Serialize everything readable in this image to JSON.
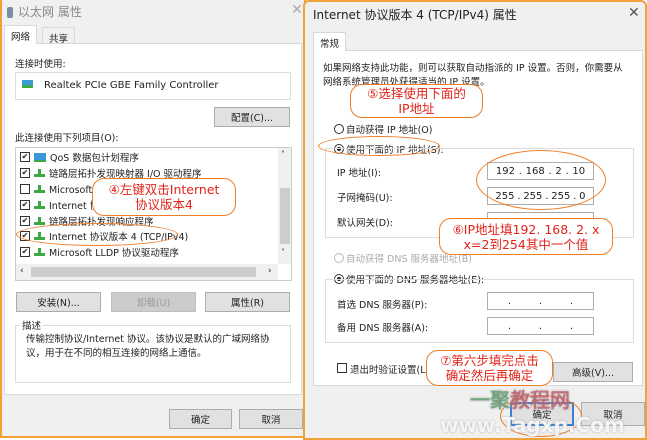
{
  "left_dialog": {
    "title": "以太网 属性",
    "tabs": [
      "网络",
      "共享"
    ],
    "connect_using_label": "连接时使用:",
    "adapter": "Realtek PCIe GBE Family Controller",
    "configure_button": "配置(C)...",
    "items_label": "此连接使用下列项目(O):",
    "items": [
      {
        "label": "QoS 数据包计划程序",
        "checked": true
      },
      {
        "label": "链路层拓扑发现映射器 I/O 驱动程序",
        "checked": true
      },
      {
        "label": "Microsoft 网络适配器多路传送器协议",
        "checked": false
      },
      {
        "label": "Internet 协议版本 6 (TCP/IPv6)",
        "checked": true
      },
      {
        "label": "链路层拓扑发现响应程序",
        "checked": true
      },
      {
        "label": "Internet 协议版本 4 (TCP/IPv4)",
        "checked": true
      },
      {
        "label": "Microsoft LLDP 协议驱动程序",
        "checked": true
      }
    ],
    "install_button": "安装(N)...",
    "uninstall_button": "卸载(U)",
    "properties_button": "属性(R)",
    "description_label": "描述",
    "description_text": "传输控制协议/Internet 协议。该协议是默认的广域网络协议，用于在不同的相互连接的网络上通信。",
    "ok_button": "确定",
    "cancel_button": "取消"
  },
  "right_dialog": {
    "title": "Internet 协议版本 4 (TCP/IPv4) 属性",
    "tab": "常规",
    "intro": "如果网络支持此功能，则可以获取自动指派的 IP 设置。否则，你需要从网络系统管理员处获得适当的 IP 设置。",
    "auto_ip": "自动获得 IP 地址(O)",
    "manual_ip": "使用下面的 IP 地址(S):",
    "ip_label": "IP 地址(I):",
    "ip_value": [
      "192",
      "168",
      "2",
      "10"
    ],
    "subnet_label": "子网掩码(U):",
    "subnet_value": [
      "255",
      "255",
      "255",
      "0"
    ],
    "gateway_label": "默认网关(D):",
    "auto_dns": "自动获得 DNS 服务器地址(B)",
    "manual_dns": "使用下面的 DNS 服务器地址(E):",
    "preferred_dns_label": "首选 DNS 服务器(P):",
    "alternate_dns_label": "备用 DNS 服务器(A):",
    "validate_label": "退出时验证设置(L)",
    "advanced_button": "高级(V)...",
    "ok_button": "确定",
    "cancel_button": "取消"
  },
  "annotations": {
    "step4": [
      "④左键双击Internet",
      "协议版本4"
    ],
    "step5": [
      "⑤选择使用下面的",
      "IP地址"
    ],
    "step6": [
      "⑥IP地址填192. 168. 2. x",
      "x=2到254其中一个值"
    ],
    "step7": [
      "⑦第六步填完点击",
      "确定然后再确定"
    ]
  },
  "watermark": "一聚教程网 www.Tagxp.Com",
  "colors": {
    "accent": "#f07c26",
    "annotation_text": "#e2231a",
    "window_border": "#f0a23a"
  }
}
